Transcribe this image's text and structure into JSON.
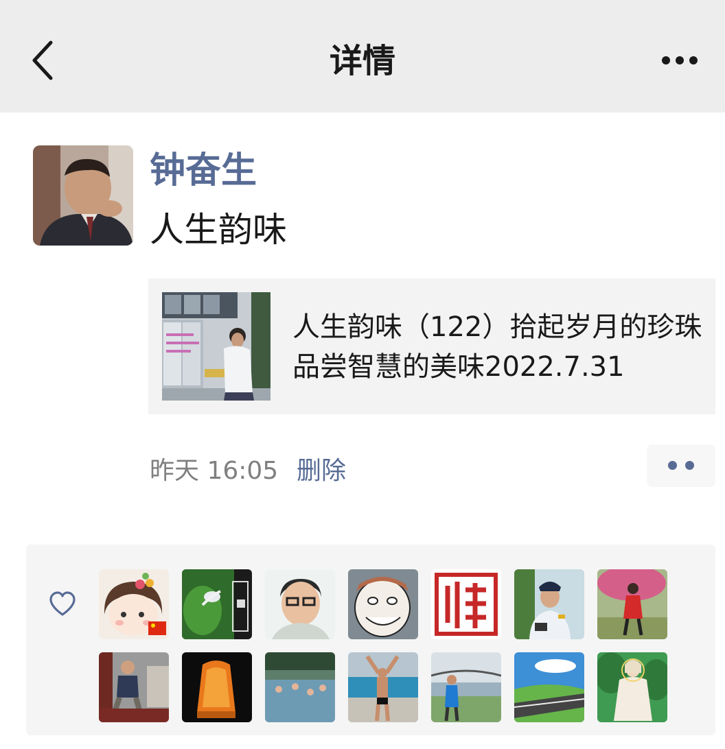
{
  "header": {
    "title": "详情",
    "back_icon": "chevron-left-icon",
    "more_icon": "ellipsis-icon"
  },
  "post": {
    "author": "钟奋生",
    "text": "人生韵味",
    "link": {
      "title": "人生韵味（122）拾起岁月的珍珠 品尝智慧的美味2022.7.31"
    },
    "time": "昨天 16:05",
    "delete_label": "删除",
    "action_icon": "two-dots-icon"
  },
  "likes": {
    "icon": "heart-outline-icon",
    "avatar_count": 14
  },
  "colors": {
    "header_bg": "#ededed",
    "link_blue": "#576b95",
    "card_bg": "#f3f3f3",
    "likes_bg": "#f5f5f5"
  }
}
